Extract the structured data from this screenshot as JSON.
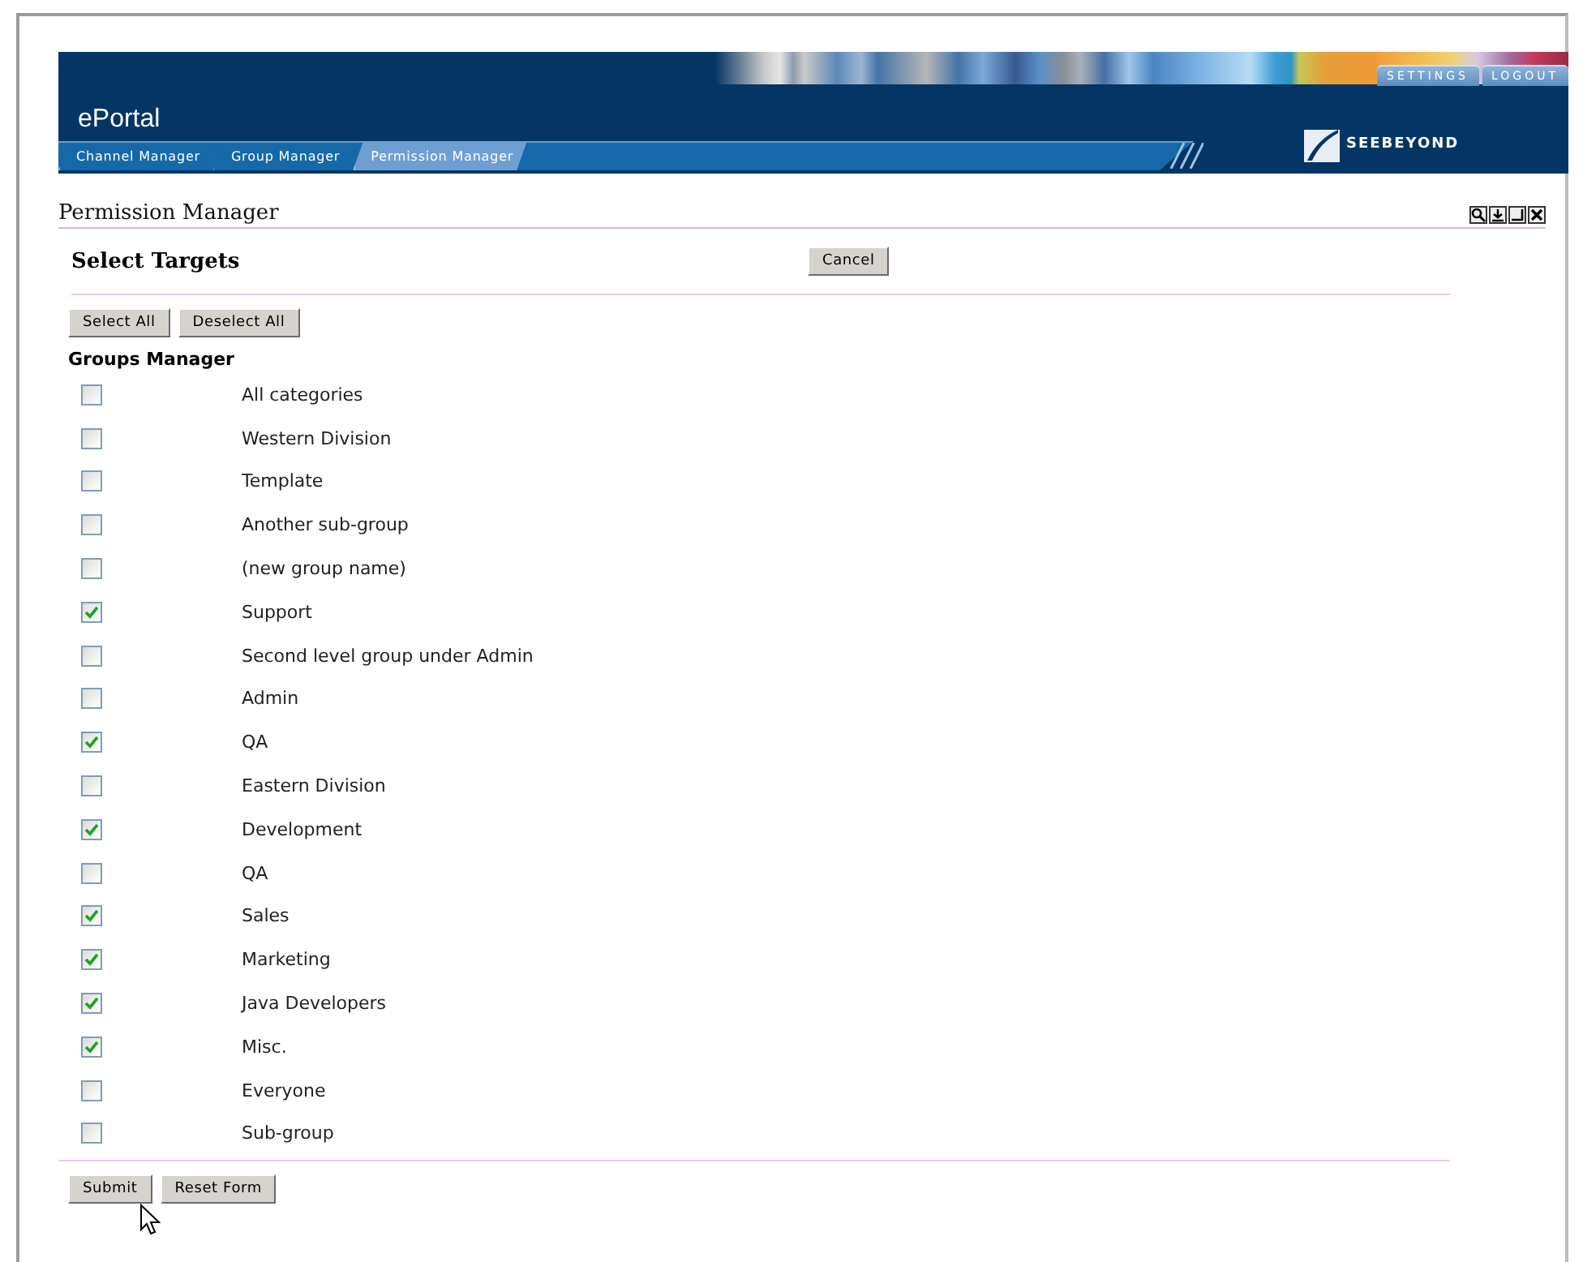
{
  "header": {
    "app_title": "ePortal",
    "logo_text": "SEEBEYOND",
    "top_links": [
      "SETTINGS",
      "LOGOUT"
    ],
    "tabs": [
      {
        "label": "Channel Manager",
        "selected": false
      },
      {
        "label": "Group Manager",
        "selected": false
      },
      {
        "label": "Permission Manager",
        "selected": true
      }
    ]
  },
  "portlet": {
    "title": "Permission Manager",
    "section_title": "Select Targets",
    "cancel_button": "Cancel",
    "select_buttons": [
      "Select All",
      "Deselect All"
    ],
    "list_title": "Groups Manager",
    "groups": [
      {
        "label": "All categories",
        "checked": false
      },
      {
        "label": "Western Division",
        "checked": false
      },
      {
        "label": "Template",
        "checked": false
      },
      {
        "label": "Another sub-group",
        "checked": false
      },
      {
        "label": "(new group name)",
        "checked": false
      },
      {
        "label": "Support",
        "checked": true
      },
      {
        "label": "Second level group under Admin",
        "checked": false
      },
      {
        "label": "Admin",
        "checked": false
      },
      {
        "label": "QA",
        "checked": true
      },
      {
        "label": "Eastern Division",
        "checked": false
      },
      {
        "label": "Development",
        "checked": true
      },
      {
        "label": "QA",
        "checked": false
      },
      {
        "label": "Sales",
        "checked": true
      },
      {
        "label": "Marketing",
        "checked": true
      },
      {
        "label": "Java Developers",
        "checked": true
      },
      {
        "label": "Misc.",
        "checked": true
      },
      {
        "label": "Everyone",
        "checked": false
      },
      {
        "label": "Sub-group",
        "checked": false
      }
    ],
    "form_buttons": [
      "Submit",
      "Reset Form"
    ]
  }
}
